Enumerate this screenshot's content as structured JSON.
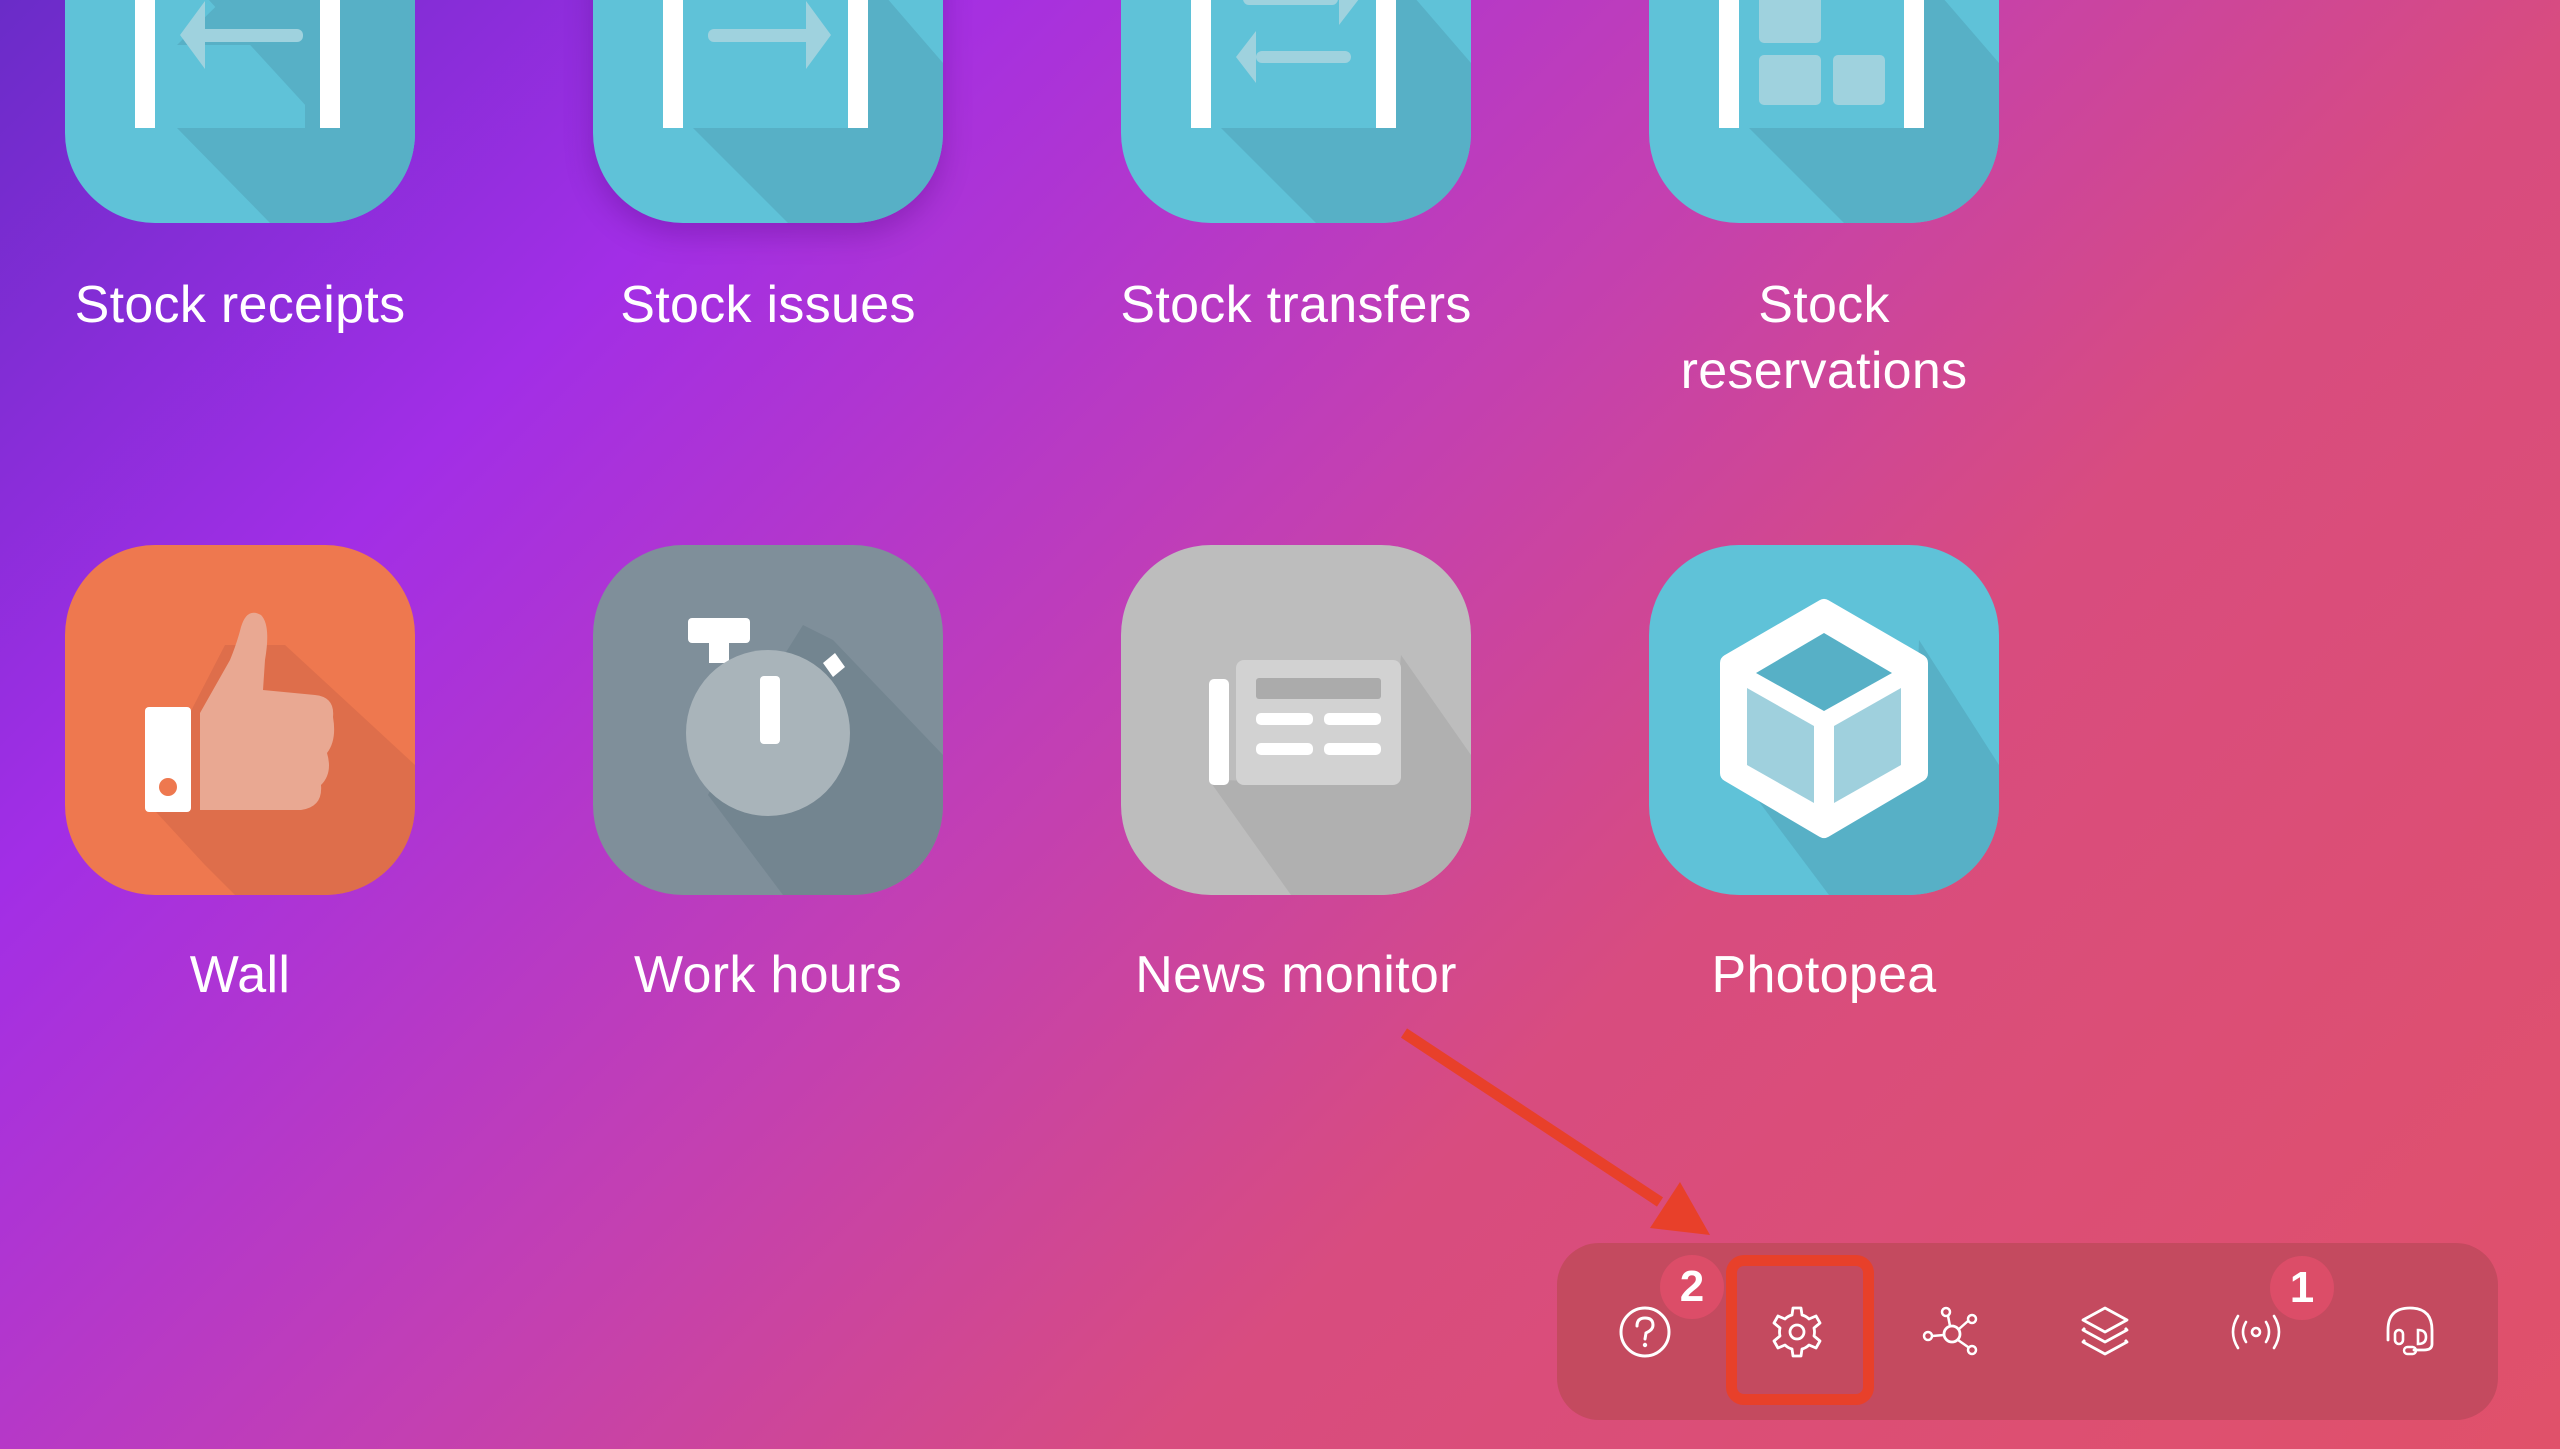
{
  "apps": [
    {
      "label": "Stock receipts",
      "icon": "warehouse-receipt-icon",
      "color": "#5fc2d8"
    },
    {
      "label": "Stock issues",
      "icon": "warehouse-issue-icon",
      "color": "#5fc2d8"
    },
    {
      "label": "Stock transfers",
      "icon": "warehouse-transfer-icon",
      "color": "#5fc2d8"
    },
    {
      "label_line1": "Stock",
      "label_line2": "reservations",
      "label": "Stock reservations",
      "icon": "warehouse-reservation-icon",
      "color": "#5fc2d8"
    },
    {
      "label": "Wall",
      "icon": "thumbs-up-icon",
      "color": "#ee784f"
    },
    {
      "label": "Work hours",
      "icon": "stopwatch-icon",
      "color": "#7f8f9a"
    },
    {
      "label": "News monitor",
      "icon": "newspaper-icon",
      "color": "#bdbdbd"
    },
    {
      "label": "Photopea",
      "icon": "cube-icon",
      "color": "#5fc2d8"
    }
  ],
  "toolbar": {
    "buttons": [
      {
        "name": "help",
        "icon": "question-circle-icon"
      },
      {
        "name": "settings",
        "icon": "gear-icon",
        "highlighted": true
      },
      {
        "name": "integrations",
        "icon": "network-nodes-icon"
      },
      {
        "name": "layers",
        "icon": "layers-icon"
      },
      {
        "name": "broadcast",
        "icon": "broadcast-icon"
      },
      {
        "name": "support",
        "icon": "headset-icon"
      }
    ]
  },
  "annotations": {
    "step_badges": [
      {
        "number": "2",
        "target": "settings"
      },
      {
        "number": "1",
        "target": "broadcast"
      }
    ],
    "highlight_color": "#e8402a",
    "arrow_color": "#e8402a"
  },
  "colors": {
    "gradient_start": "#6a2cc8",
    "gradient_mid": "#a22ee6",
    "gradient_end": "#e0516a",
    "toolbar_bg": "#c44a5f",
    "badge_bg": "#dc4d68"
  }
}
